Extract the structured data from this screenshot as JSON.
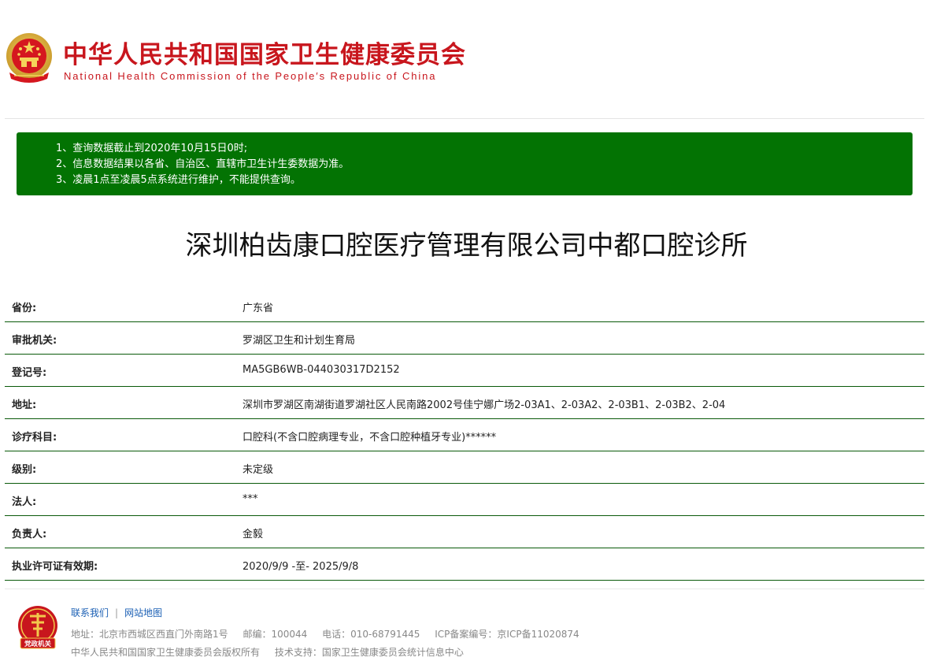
{
  "header": {
    "title": "中华人民共和国国家卫生健康委员会",
    "subtitle": "National Health Commission of the People′s Republic of China",
    "emblem_icon": "national-emblem-icon"
  },
  "notice": {
    "lines": [
      "1、查询数据截止到2020年10月15日0时;",
      "2、信息数据结果以各省、自治区、直辖市卫生计生委数据为准。",
      "3、凌晨1点至凌晨5点系统进行维护，不能提供查询。"
    ]
  },
  "page_title": "深圳柏齿康口腔医疗管理有限公司中都口腔诊所",
  "info": {
    "rows": [
      {
        "label": "省份:",
        "value": "广东省"
      },
      {
        "label": "审批机关:",
        "value": "罗湖区卫生和计划生育局"
      },
      {
        "label": "登记号:",
        "value": "MA5GB6WB-044030317D2152"
      },
      {
        "label": "地址:",
        "value": "深圳市罗湖区南湖街道罗湖社区人民南路2002号佳宁娜广场2-03A1、2-03A2、2-03B1、2-03B2、2-04"
      },
      {
        "label": "诊疗科目:",
        "value": "口腔科(不含口腔病理专业，不含口腔种植牙专业)******"
      },
      {
        "label": "级别:",
        "value": "未定级"
      },
      {
        "label": "法人:",
        "value": "***"
      },
      {
        "label": "负责人:",
        "value": "金毅"
      },
      {
        "label": "执业许可证有效期:",
        "value": "2020/9/9 -至- 2025/9/8"
      }
    ]
  },
  "footer": {
    "links": {
      "contact": "联系我们",
      "sitemap": "网站地图",
      "separator": "|"
    },
    "address": "地址：北京市西城区西直门外南路1号",
    "postcode": "邮编：100044",
    "phone": "电话：010-68791445",
    "icp": "ICP备案编号：京ICP备11020874",
    "copyright": "中华人民共和国国家卫生健康委员会版权所有",
    "tech_support": "技术支持：国家卫生健康委员会统计信息中心",
    "badge_text": "党政机关"
  },
  "colors": {
    "brand_red": "#c8161d",
    "notice_green": "#037303",
    "row_divider": "#0a5a0a",
    "link_blue": "#1a5fb4"
  }
}
